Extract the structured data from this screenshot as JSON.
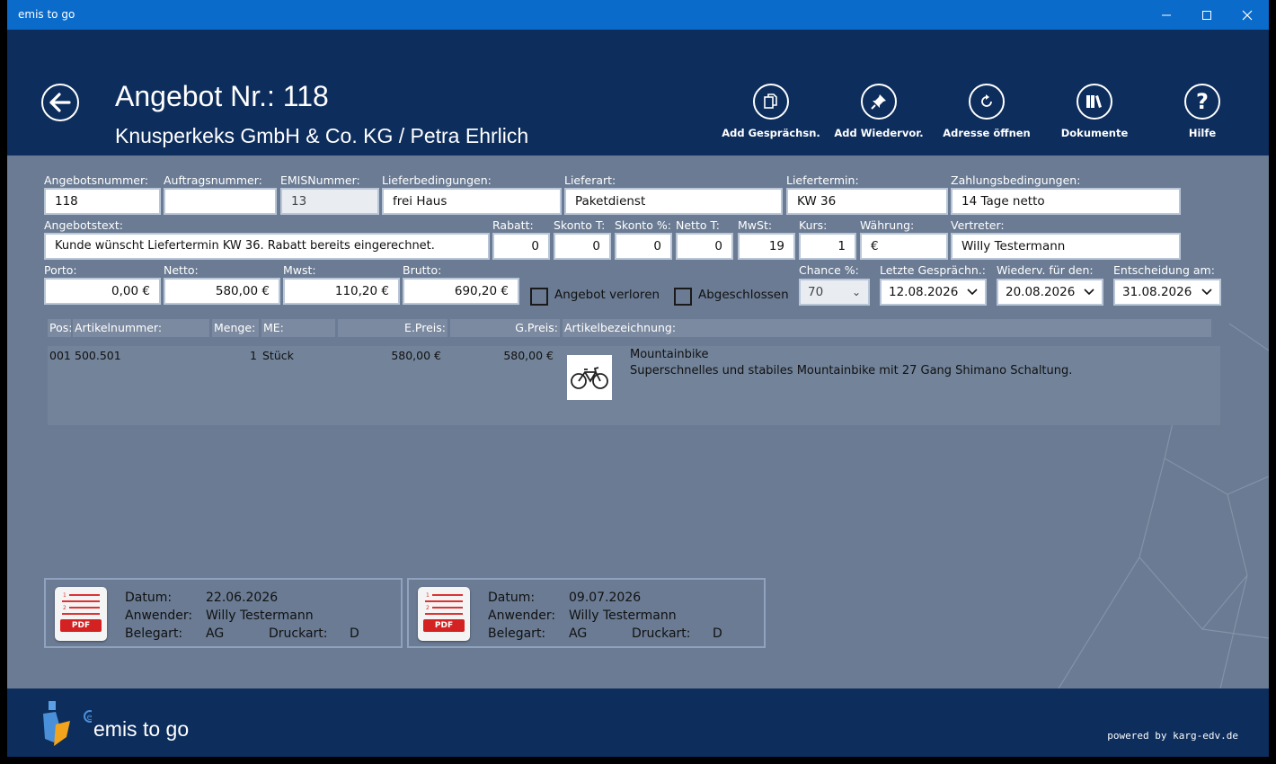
{
  "window": {
    "title": "emis to go"
  },
  "header": {
    "title": "Angebot Nr.: 118",
    "subtitle": "Knusperkeks GmbH & Co. KG / Petra Ehrlich",
    "toolbar": [
      {
        "label": "Add Gesprächsn.",
        "icon": "documents-icon"
      },
      {
        "label": "Add Wiedervor.",
        "icon": "pin-icon"
      },
      {
        "label": "Adresse öffnen",
        "icon": "refresh-icon"
      },
      {
        "label": "Dokumente",
        "icon": "books-icon"
      },
      {
        "label": "Hilfe",
        "icon": "help-icon"
      }
    ]
  },
  "form": {
    "angebotsnummer": {
      "label": "Angebotsnummer:",
      "value": "118"
    },
    "auftragsnummer": {
      "label": "Auftragsnummer:",
      "value": ""
    },
    "emisnummer": {
      "label": "EMISNummer:",
      "value": "13"
    },
    "lieferbedingungen": {
      "label": "Lieferbedingungen:",
      "value": "frei Haus"
    },
    "lieferart": {
      "label": "Lieferart:",
      "value": "Paketdienst"
    },
    "liefertermin": {
      "label": "Liefertermin:",
      "value": "KW 36"
    },
    "zahlungsbedingungen": {
      "label": "Zahlungsbedingungen:",
      "value": "14 Tage netto"
    },
    "angebotstext": {
      "label": "Angebotstext:",
      "value": "Kunde wünscht Liefertermin KW 36. Rabatt bereits eingerechnet."
    },
    "rabatt": {
      "label": "Rabatt:",
      "value": "0"
    },
    "skonto_t": {
      "label": "Skonto T:",
      "value": "0"
    },
    "skonto_p": {
      "label": "Skonto %:",
      "value": "0"
    },
    "netto_t": {
      "label": "Netto T:",
      "value": "0"
    },
    "mwst_rate": {
      "label": "MwSt:",
      "value": "19"
    },
    "kurs": {
      "label": "Kurs:",
      "value": "1"
    },
    "waehrung": {
      "label": "Währung:",
      "value": "€"
    },
    "vertreter": {
      "label": "Vertreter:",
      "value": "Willy Testermann"
    },
    "porto": {
      "label": "Porto:",
      "value": "0,00 €"
    },
    "netto": {
      "label": "Netto:",
      "value": "580,00 €"
    },
    "mwst": {
      "label": "Mwst:",
      "value": "110,20 €"
    },
    "brutto": {
      "label": "Brutto:",
      "value": "690,20 €"
    },
    "angebot_verloren": {
      "label": "Angebot verloren",
      "checked": false
    },
    "abgeschlossen": {
      "label": "Abgeschlossen",
      "checked": false
    },
    "chance": {
      "label": "Chance %:",
      "value": "70"
    },
    "letzte_gespraechn": {
      "label": "Letzte Gesprächn.:",
      "value": "12.08.2026"
    },
    "wiedervorlage": {
      "label": "Wiederv. für den:",
      "value": "20.08.2026"
    },
    "entscheidung": {
      "label": "Entscheidung am:",
      "value": "31.08.2026"
    }
  },
  "grid": {
    "columns": [
      "Pos:",
      "Artikelnummer:",
      "Menge:",
      "ME:",
      "E.Preis:",
      "G.Preis:",
      "Artikelbezeichnung:"
    ],
    "rows": [
      {
        "pos": "001",
        "artikelnummer": "500.501",
        "menge": "1",
        "me": "Stück",
        "epreis": "580,00 €",
        "gpreis": "580,00 €",
        "title": "Mountainbike",
        "description": "Superschnelles und stabiles Mountainbike mit 27 Gang Shimano Schaltung."
      }
    ]
  },
  "documents": [
    {
      "datum_label": "Datum:",
      "datum": "22.06.2026",
      "anwender_label": "Anwender:",
      "anwender": "Willy Testermann",
      "belegart_label": "Belegart:",
      "belegart": "AG",
      "druckart_label": "Druckart:",
      "druckart": "D",
      "badge": "PDF"
    },
    {
      "datum_label": "Datum:",
      "datum": "09.07.2026",
      "anwender_label": "Anwender:",
      "anwender": "Willy Testermann",
      "belegart_label": "Belegart:",
      "belegart": "AG",
      "druckart_label": "Druckart:",
      "druckart": "D",
      "badge": "PDF"
    }
  ],
  "footer": {
    "brand": "emis to go",
    "powered": "powered by karg-edv.de"
  }
}
